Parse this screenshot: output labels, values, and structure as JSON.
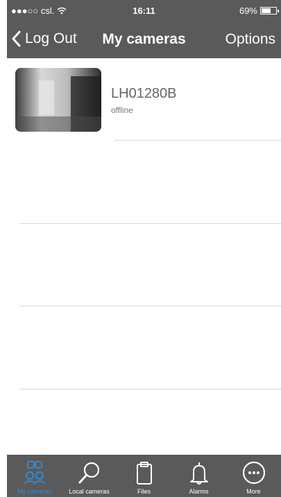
{
  "status_bar": {
    "carrier": "●●●○○ csl.",
    "time": "16:11",
    "battery": "69%",
    "battery_level": 0.69
  },
  "nav": {
    "back_label": "Log Out",
    "title": "My cameras",
    "options_label": "Options"
  },
  "cameras": [
    {
      "name": "LH01280B",
      "status": "offline"
    }
  ],
  "tabs": [
    {
      "label": "My cameras",
      "icon": "cameras-icon",
      "active": true
    },
    {
      "label": "Local cameras",
      "icon": "search-icon",
      "active": false
    },
    {
      "label": "Files",
      "icon": "clipboard-icon",
      "active": false
    },
    {
      "label": "Alarms",
      "icon": "bell-icon",
      "active": false
    },
    {
      "label": "More",
      "icon": "more-icon",
      "active": false
    }
  ],
  "colors": {
    "bar_background": "#5a5a5a",
    "active_tab": "#2f8bd8"
  }
}
